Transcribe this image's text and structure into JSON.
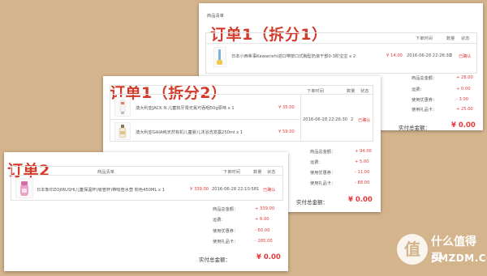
{
  "card1": {
    "list_title": "商品清单",
    "overlay": "订单1（拆分1）",
    "headers": {
      "time": "下单时间",
      "qty": "数量",
      "status": "状态"
    },
    "item": {
      "name": "日本小西希事Kawanishi进口带按口式胸型奶滚干部0-3阶宝宝 x 2",
      "price": "¥ 14.00",
      "time": "2016-06-28 22:26:30",
      "qty": "2",
      "status": "已确认"
    },
    "summary": [
      {
        "label": "商品总金额：",
        "value": "+ 28.00"
      },
      {
        "label": "运费：",
        "value": "+ 0.00"
      },
      {
        "label": "使用优惠券：",
        "value": "- 3.00"
      },
      {
        "label": "使用礼品卡：",
        "value": "+ 25.00"
      }
    ],
    "total_label": "实付总金额：",
    "total_value": "¥ 0.00"
  },
  "card2": {
    "overlay": "订单1（拆分2）",
    "headers": {
      "time": "下单时间",
      "qty": "数量",
      "status": "状态"
    },
    "items": [
      {
        "name": "澳大利亚JACK N   儿童软牙膏无氟可吞咽50g原味 x 1",
        "price": "¥ 35.00"
      },
      {
        "name": "澳大利亚GAIA纯天然有机儿童婴儿沐浴洗发露250ml x 1",
        "price": "¥ 59.00"
      }
    ],
    "time": "2016-06-28 22:26:30",
    "qty": "2",
    "status": "已确认",
    "summary": [
      {
        "label": "商品总金额：",
        "value": "+ 94.00"
      },
      {
        "label": "运费：",
        "value": "+ 5.00"
      },
      {
        "label": "使用优惠券：",
        "value": "- 11.00"
      },
      {
        "label": "使用礼品卡：",
        "value": "- 88.00"
      }
    ],
    "total_label": "实付总金额：",
    "total_value": "¥ 0.00"
  },
  "card3": {
    "overlay": "订单2",
    "headers": {
      "list": "商品清单",
      "time": "下单时间",
      "qty": "数量",
      "status": "状态"
    },
    "item": {
      "name": "日本象印ZOJIRUSHI儿童保温杯(吸管杯)带吸管水壶 粉色450ML x 1",
      "price": "¥ 339.00",
      "time": "2016-06-28 22:10:58",
      "qty": "1",
      "status": "已确认"
    },
    "summary": [
      {
        "label": "商品总金额：",
        "value": "+ 339.00"
      },
      {
        "label": "运费：",
        "value": "+ 6.00"
      },
      {
        "label": "使用优惠券：",
        "value": "- 60.00"
      },
      {
        "label": "使用礼品卡：",
        "value": "- 285.00"
      }
    ],
    "total_label": "实付总金额：",
    "total_value": "¥ 0.00"
  },
  "watermark": {
    "text": "什么值得买",
    "url": "SMZDM.COM"
  },
  "colors": {
    "background": "#d4b48c",
    "accent_red": "#d33a2a",
    "price_red": "#e4393c"
  }
}
